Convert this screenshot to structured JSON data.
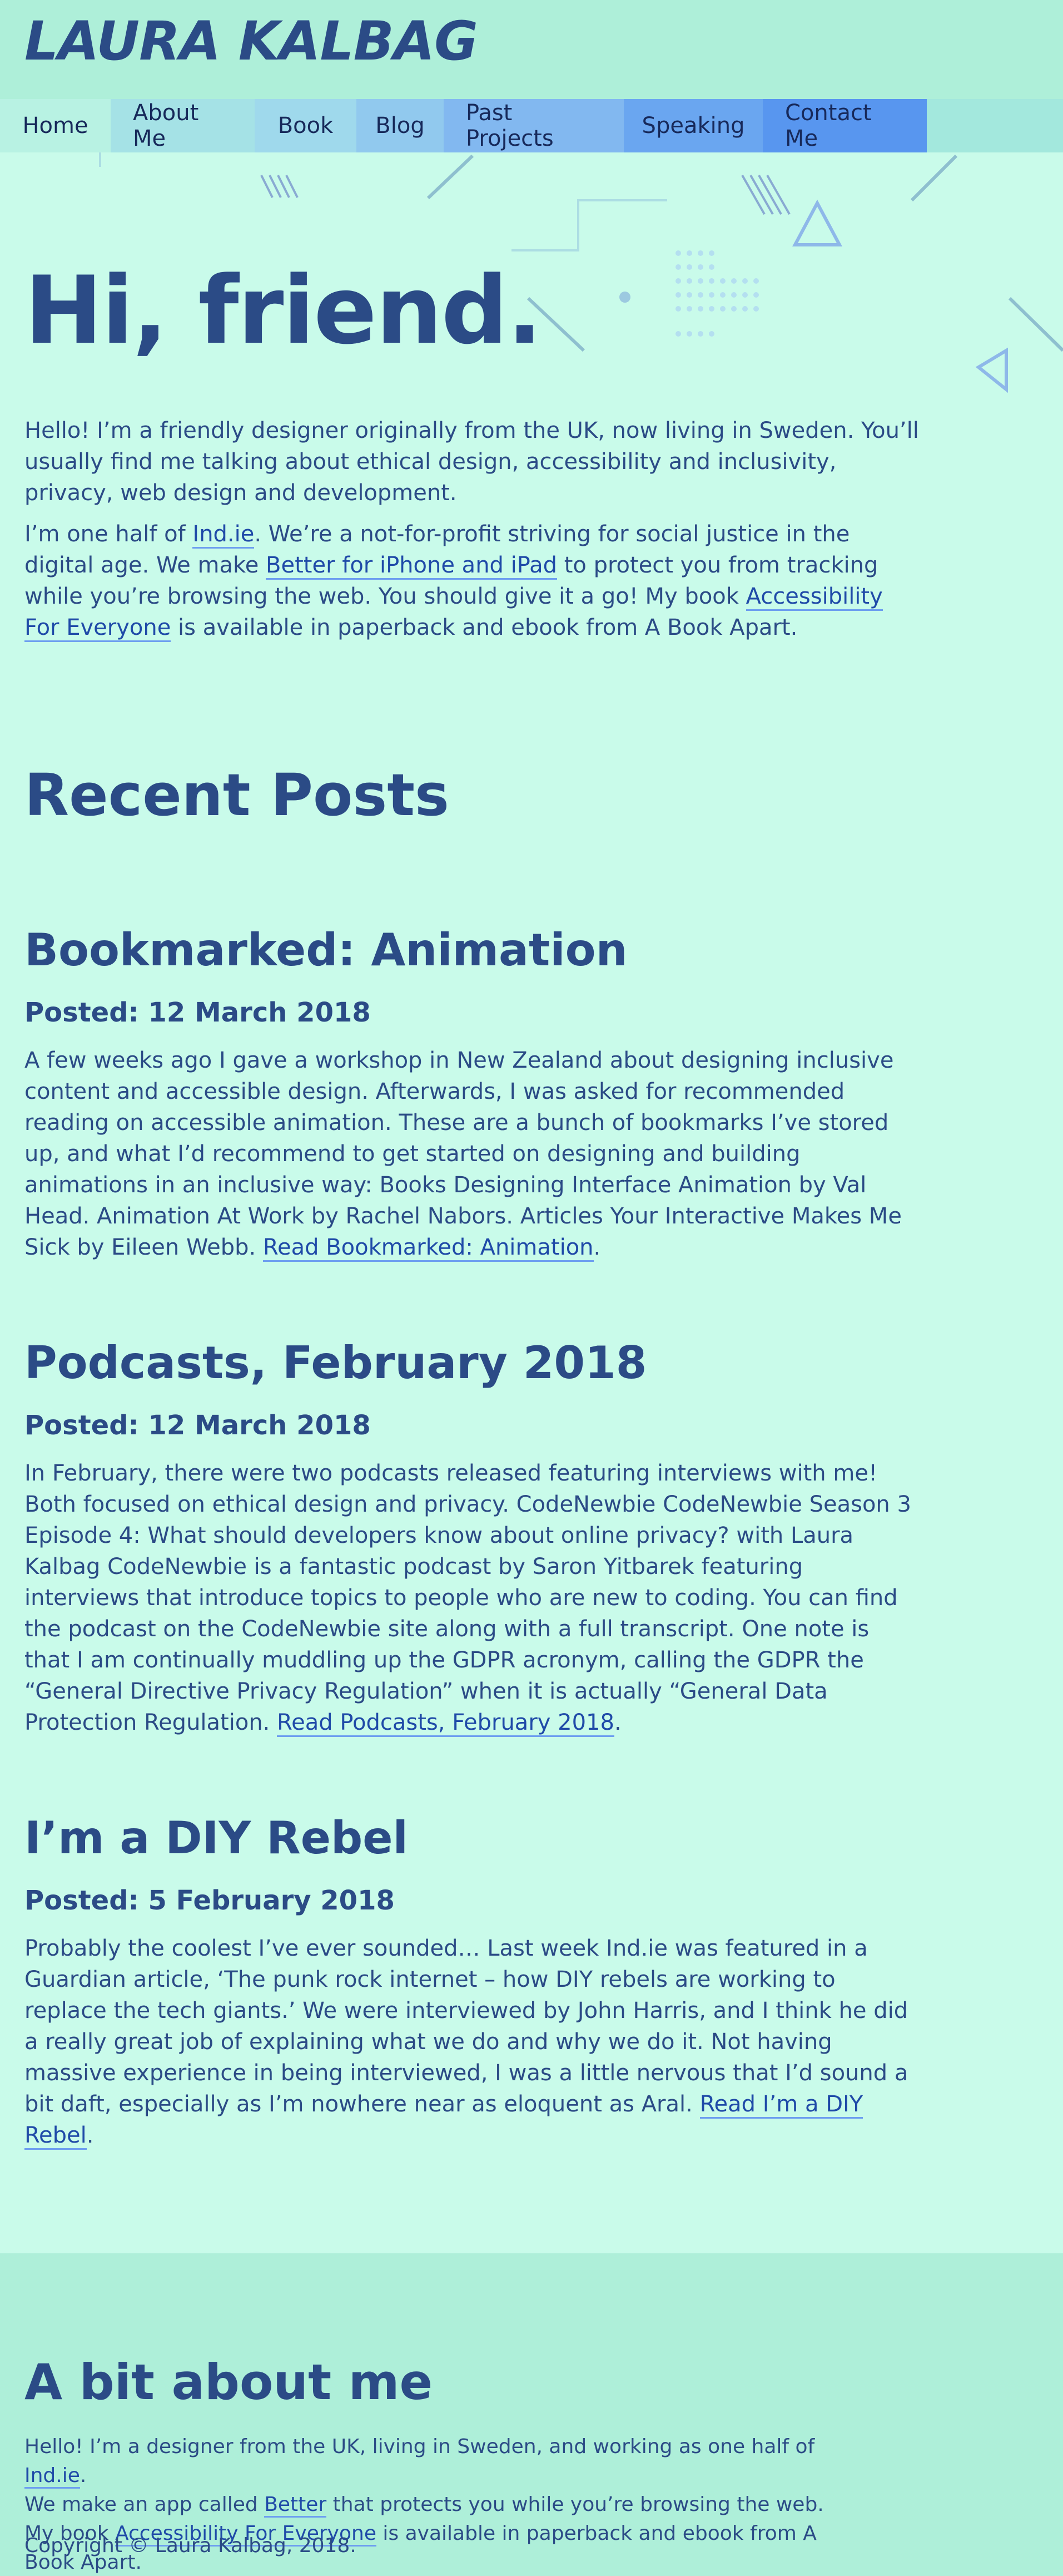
{
  "site": {
    "logo": "LAURA KALBAG"
  },
  "nav": {
    "items": [
      {
        "label": "Home"
      },
      {
        "label": "About Me"
      },
      {
        "label": "Book"
      },
      {
        "label": "Blog"
      },
      {
        "label": "Past Projects"
      },
      {
        "label": "Speaking"
      },
      {
        "label": "Contact Me"
      }
    ]
  },
  "hero": {
    "title": "Hi, friend."
  },
  "intro": {
    "p1": "Hello! I’m a friendly designer originally from the UK, now living in Sweden. You’ll usually find me talking about ethical design, accessibility and inclusivity, privacy, web design and development.",
    "p2_a": "I’m one half of ",
    "p2_link1": "Ind.ie",
    "p2_b": ". We’re a not-for-profit striving for social justice in the digital age. We make ",
    "p2_link2": "Better for iPhone and iPad",
    "p2_c": " to protect you from tracking while you’re browsing the web. You should give it a go! My book ",
    "p2_link3": "Accessibility For Everyone",
    "p2_d": " is available in paperback and ebook from A Book Apart."
  },
  "recent": {
    "title": "Recent Posts"
  },
  "posts": [
    {
      "title": "Bookmarked: Animation",
      "posted": "Posted: 12 March 2018",
      "excerpt": "A few weeks ago I gave a workshop in New Zealand about designing inclusive content and accessible design. Afterwards, I was asked for recommended reading on accessible animation. These are a bunch of bookmarks I’ve stored up, and what I’d recommend to get started on designing and building animations in an inclusive way: Books Designing Interface Animation by Val Head. Animation At Work by Rachel Nabors. Articles Your Interactive Makes Me Sick by Eileen Webb. ",
      "read_more": "Read Bookmarked: Animation"
    },
    {
      "title": "Podcasts, February 2018",
      "posted": "Posted: 12 March 2018",
      "excerpt": "In February, there were two podcasts released featuring interviews with me! Both focused on ethical design and privacy. CodeNewbie CodeNewbie Season 3 Episode 4: What should developers know about online privacy? with Laura Kalbag CodeNewbie is a fantastic podcast by Saron Yitbarek featuring interviews that introduce topics to people who are new to coding. You can find the podcast on the CodeNewbie site along with a full transcript. One note is that I am continually muddling up the GDPR acronym, calling the GDPR the “General Directive Privacy Regulation” when it is actually “General Data Protection Regulation. ",
      "read_more": "Read Podcasts, February 2018"
    },
    {
      "title": "I’m a DIY Rebel",
      "posted": "Posted: 5 February 2018",
      "excerpt": "Probably the coolest I’ve ever sounded… Last week Ind.ie was featured in a Guardian article, ‘The punk rock internet – how DIY rebels are working to replace the tech giants.’ We were interviewed by John Harris, and I think he did a really great job of explaining what we do and why we do it. Not having massive experience in being interviewed, I was a little nervous that I’d sound a bit daft, especially as I’m nowhere near as eloquent as Aral. ",
      "read_more": "Read I’m a DIY Rebel"
    }
  ],
  "footer": {
    "title": "A bit about me",
    "a": "Hello! I’m a designer from the UK, living in Sweden, and working as one half of ",
    "link1": "Ind.ie",
    "b": ".",
    "c": "We make an app called ",
    "link2": "Better",
    "d": " that protects you while you’re browsing the web. My book ",
    "link3": "Accessibility For Everyone",
    "e": " is available in paperback and ebook from A Book Apart.",
    "copyright": "Copyright © Laura Kalbag, 2018."
  },
  "colors": {
    "background": "#c9fbea",
    "header": "#aeefd9",
    "text": "#2b4b86",
    "link_underline": "#6d9ef0"
  }
}
